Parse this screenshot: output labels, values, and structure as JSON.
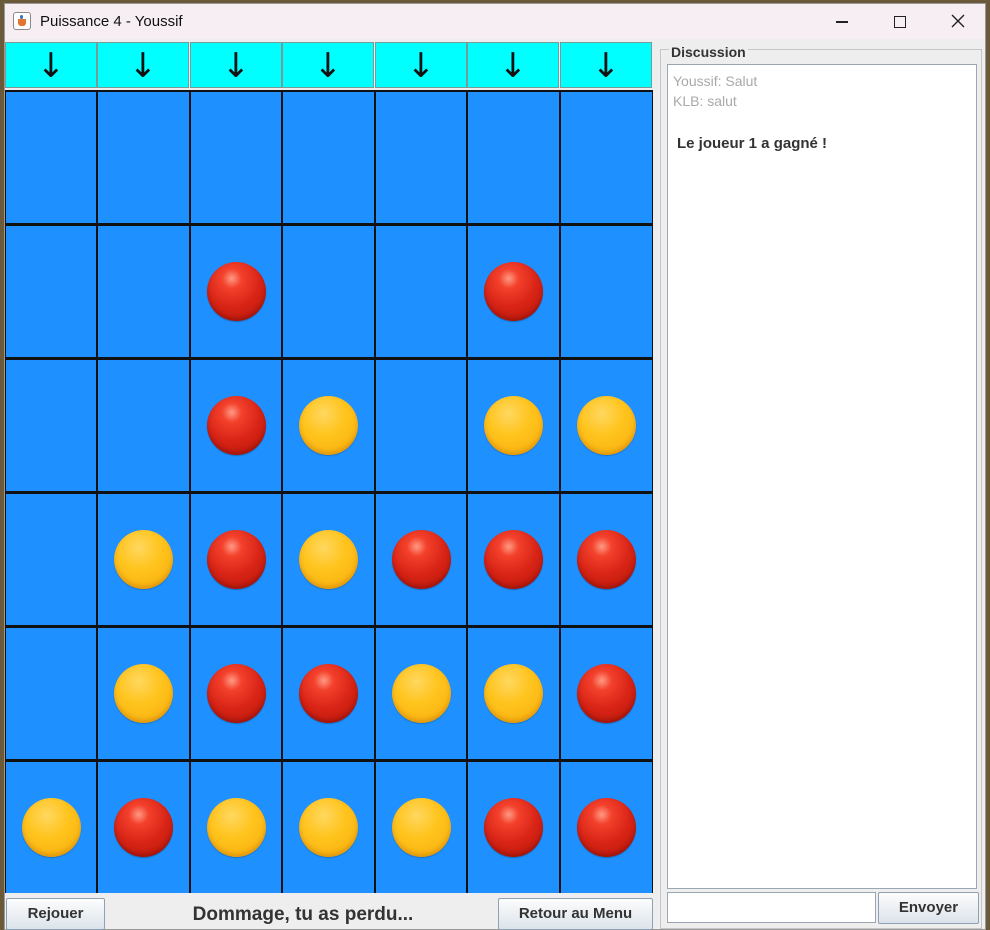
{
  "window": {
    "title": "Puissance 4 - Youssif",
    "icon": "java-cup-icon",
    "controls": [
      "minimize-icon",
      "maximize-icon",
      "close-icon"
    ]
  },
  "drop_arrows": [
    "↓",
    "↓",
    "↓",
    "↓",
    "↓",
    "↓",
    "↓"
  ],
  "board": {
    "rows": 6,
    "cols": 7,
    "cells": [
      [
        "",
        "",
        "",
        "",
        "",
        "",
        ""
      ],
      [
        "",
        "",
        "R",
        "",
        "",
        "R",
        ""
      ],
      [
        "",
        "",
        "R",
        "Y",
        "",
        "Y",
        "Y"
      ],
      [
        "",
        "Y",
        "R",
        "Y",
        "R",
        "R",
        "R"
      ],
      [
        "",
        "Y",
        "R",
        "R",
        "Y",
        "Y",
        "R"
      ],
      [
        "Y",
        "R",
        "Y",
        "Y",
        "Y",
        "R",
        "R"
      ]
    ],
    "colors": {
      "cell_background": "#1e90ff",
      "grid_line": "#111111",
      "arrow_background": "#00ffff",
      "red_disc": "#d82416",
      "yellow_disc": "#ffc41e"
    }
  },
  "controls": {
    "replay_label": "Rejouer",
    "status_text": "Dommage, tu as perdu...",
    "menu_label": "Retour au Menu"
  },
  "chat": {
    "legend": "Discussion",
    "messages": [
      "Youssif: Salut",
      "KLB: salut"
    ],
    "result_message": "Le joueur 1 a gagné !",
    "input_value": "",
    "send_label": "Envoyer"
  }
}
